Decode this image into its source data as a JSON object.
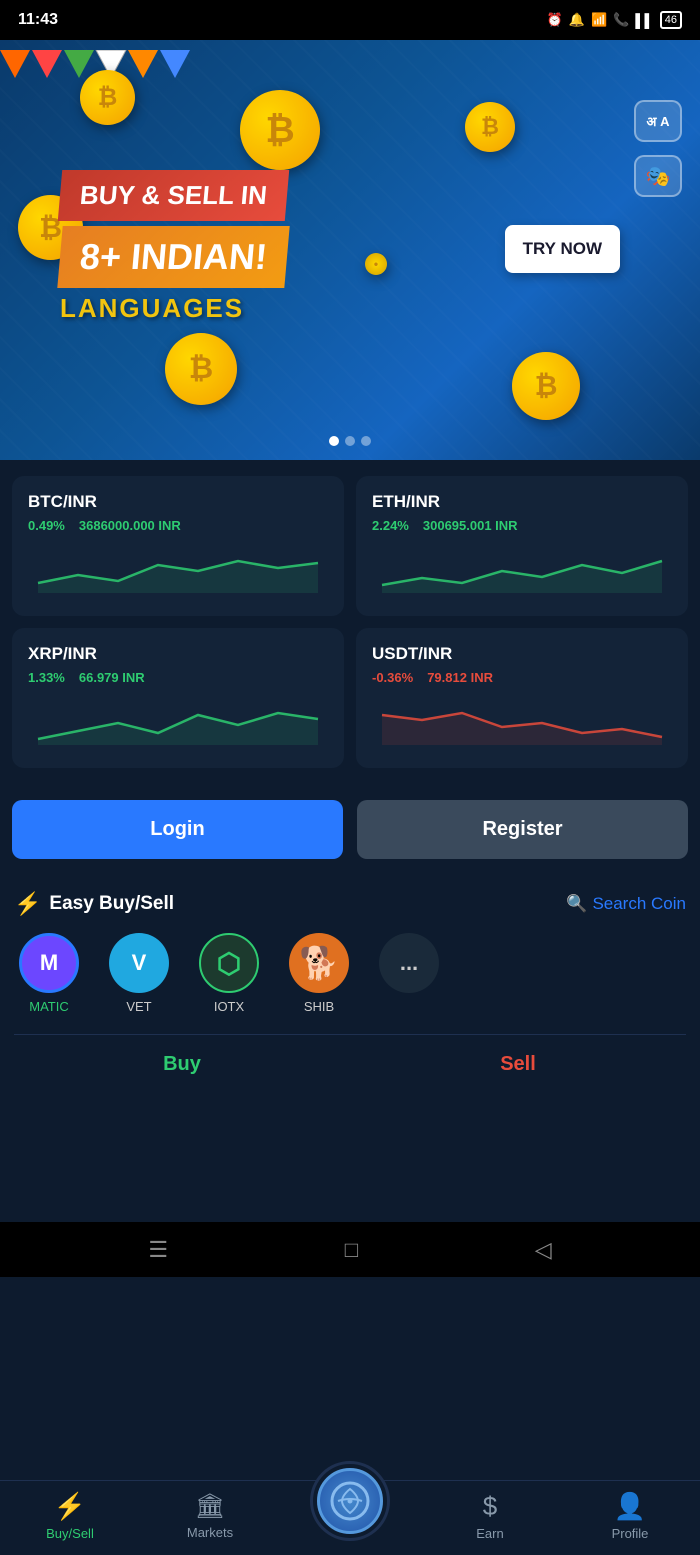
{
  "statusBar": {
    "time": "11:43",
    "batteryLevel": "46"
  },
  "banner": {
    "line1": "BUY & SELL IN",
    "line2": "8+ INDIAN!",
    "line3": "LANGUAGES",
    "tryNowLabel": "TRY NOW",
    "translateIcon1": "अ A",
    "translateIcon2": "🎭"
  },
  "marketCards": [
    {
      "pair": "BTC/INR",
      "change": "0.49%",
      "price": "3686000.000 INR",
      "direction": "up"
    },
    {
      "pair": "ETH/INR",
      "change": "2.24%",
      "price": "300695.001 INR",
      "direction": "up"
    },
    {
      "pair": "XRP/INR",
      "change": "1.33%",
      "price": "66.979 INR",
      "direction": "up"
    },
    {
      "pair": "USDT/INR",
      "change": "-0.36%",
      "price": "79.812 INR",
      "direction": "down"
    }
  ],
  "auth": {
    "loginLabel": "Login",
    "registerLabel": "Register"
  },
  "easySell": {
    "title": "Easy Buy/Sell",
    "searchLabel": "Search Coin"
  },
  "coins": [
    {
      "symbol": "MATIC",
      "iconClass": "matic",
      "icon": "M",
      "selected": true
    },
    {
      "symbol": "VET",
      "iconClass": "vet",
      "icon": "V",
      "selected": false
    },
    {
      "symbol": "IOTX",
      "iconClass": "iotx",
      "icon": "⬡",
      "selected": false
    },
    {
      "symbol": "SHIB",
      "iconClass": "shib",
      "icon": "🐕",
      "selected": false
    }
  ],
  "buySellTabs": {
    "buyLabel": "Buy",
    "sellLabel": "Sell"
  },
  "bottomNav": {
    "items": [
      {
        "id": "buysell",
        "label": "Buy/Sell",
        "icon": "⚡",
        "active": true
      },
      {
        "id": "markets",
        "label": "Markets",
        "icon": "🏛",
        "active": false
      },
      {
        "id": "earn",
        "label": "Earn",
        "icon": "$",
        "active": false
      },
      {
        "id": "profile",
        "label": "Profile",
        "icon": "👤",
        "active": false
      }
    ]
  }
}
